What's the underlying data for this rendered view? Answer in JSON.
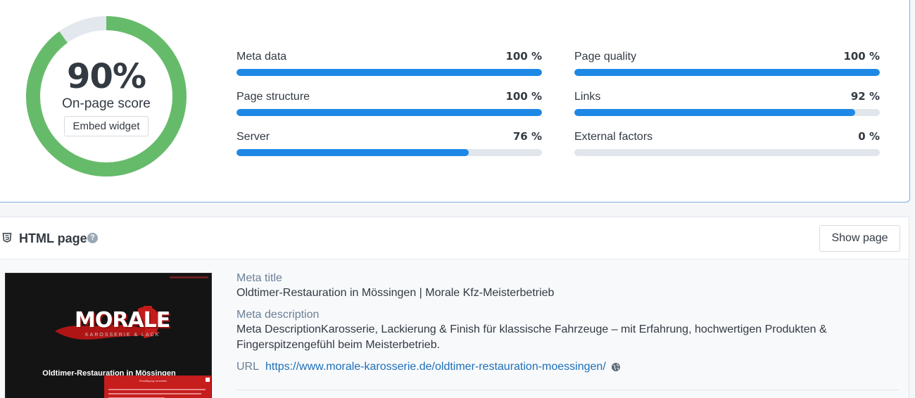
{
  "score": {
    "value": "90%",
    "fraction": 0.9,
    "label": "On-page score",
    "embed_label": "Embed widget",
    "colors": {
      "ring": "#66bb6a",
      "track": "#e3e8ee"
    }
  },
  "metrics": [
    {
      "name": "Meta data",
      "value_text": "100 %",
      "value": 100
    },
    {
      "name": "Page quality",
      "value_text": "100 %",
      "value": 100
    },
    {
      "name": "Page structure",
      "value_text": "100 %",
      "value": 100
    },
    {
      "name": "Links",
      "value_text": "92 %",
      "value": 92
    },
    {
      "name": "Server",
      "value_text": "76 %",
      "value": 76
    },
    {
      "name": "External factors",
      "value_text": "0 %",
      "value": 0
    }
  ],
  "bar_color": "#1e88e5",
  "html_page": {
    "title": "HTML page",
    "help_icon": "question-circle-icon",
    "show_button": "Show page",
    "meta_title_label": "Meta title",
    "meta_title": "Oldtimer-Restauration in Mössingen | Morale Kfz-Meisterbetrieb",
    "meta_description_label": "Meta description",
    "meta_description": "Meta DescriptionKarosserie, Lackierung & Finish für klassische Fahrzeuge – mit Erfahrung, hochwertigen Produkten & Fingerspitzengefühl beim Meisterbetrieb.",
    "url_label": "URL",
    "url": "https://www.morale-karosserie.de/oldtimer-restauration-moessingen/",
    "url_icon": "globe-icon"
  },
  "thumbnail": {
    "logo_text": "MORALE",
    "logo_sub": "KAROSSERIE & LACK",
    "heading": "Oldtimer-Restauration in Mössingen",
    "cookie_title": "Einwilligung verwalten"
  }
}
